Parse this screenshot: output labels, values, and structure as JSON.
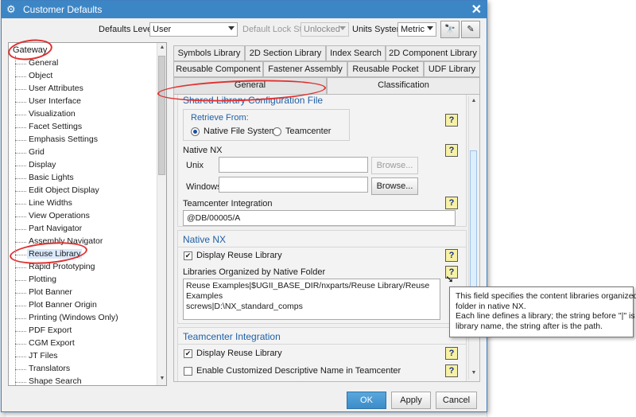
{
  "window": {
    "title": "Customer Defaults"
  },
  "toolbar": {
    "defaults_level_label": "Defaults Level",
    "defaults_level_value": "User",
    "lock_state_label": "Default Lock State",
    "lock_state_value": "Unlocked",
    "units_label": "Units System",
    "units_value": "Metric"
  },
  "tree": {
    "root": "Gateway",
    "items": [
      "General",
      "Object",
      "User Attributes",
      "User Interface",
      "Visualization",
      "Facet Settings",
      "Emphasis Settings",
      "Grid",
      "Display",
      "Basic Lights",
      "Edit Object Display",
      "Line Widths",
      "View Operations",
      "Part Navigator",
      "Assembly Navigator",
      "Reuse Library",
      "Rapid Prototyping",
      "Plotting",
      "Plot Banner",
      "Plot Banner Origin",
      "Printing (Windows Only)",
      "PDF Export",
      "CGM Export",
      "JT Files",
      "Translators",
      "Shape Search"
    ],
    "selected": "Reuse Library"
  },
  "tabs": {
    "row1": [
      "Symbols Library",
      "2D Section Library",
      "Index Search",
      "2D Component Library"
    ],
    "row2": [
      "Reusable Component",
      "Fastener Assembly",
      "Reusable Pocket",
      "UDF Library"
    ],
    "row3": [
      "General",
      "Classification"
    ],
    "active": "General"
  },
  "panel": {
    "shared_title": "Shared Library Configuration File",
    "retrieve_from": "Retrieve From:",
    "opt_native": "Native File System",
    "opt_teamcenter": "Teamcenter",
    "native_nx_label": "Native NX",
    "unix_label": "Unix",
    "windows_label": "Windows",
    "browse_label": "Browse...",
    "tc_integration_label": "Teamcenter Integration",
    "tc_integration_value": "@DB/00005/A",
    "native_section_title": "Native NX",
    "display_reuse_library": "Display Reuse Library",
    "libs_by_folder_label": "Libraries Organized by Native Folder",
    "libs_line1": "Reuse Examples|$UGII_BASE_DIR/nxparts/Reuse Library/Reuse Examples",
    "libs_line2": "screws|D:\\NX_standard_comps",
    "tc_section_title": "Teamcenter Integration",
    "tc_display_reuse_library": "Display Reuse Library",
    "enable_custom_desc": "Enable Customized Descriptive Name in Teamcenter",
    "help_glyph": "?"
  },
  "tooltip": {
    "line1": "This field specifies the content libraries organized by",
    "line2": "folder in native NX.",
    "line3": "Each line defines a library; the string before \"|\" is the",
    "line4": "library name, the string after is the path."
  },
  "footer": {
    "ok": "OK",
    "apply": "Apply",
    "cancel": "Cancel"
  }
}
